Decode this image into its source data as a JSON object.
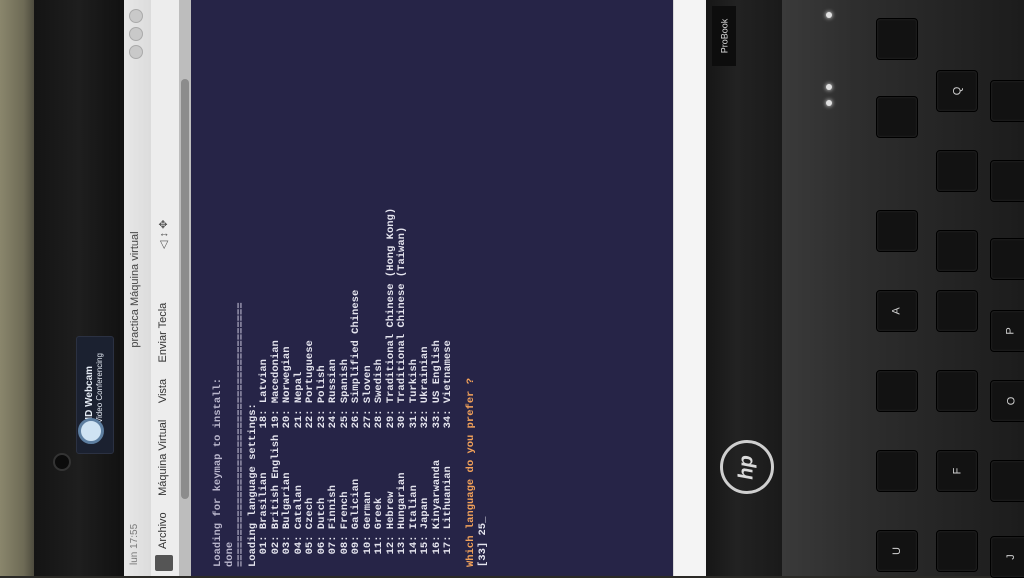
{
  "window": {
    "title": "practica Máquina virtual",
    "clock": "lun 17:55"
  },
  "menu": {
    "items": [
      "Archivo",
      "Máquina Virtual",
      "Vista",
      "Enviar Tecla"
    ]
  },
  "webcam": {
    "title": "HD Webcam",
    "subtitle": "HD Video Conferencing"
  },
  "hardware": {
    "brand": "hp",
    "model": "ProBook",
    "keys": [
      "Q",
      "A",
      "P",
      "O",
      "U",
      "J",
      "F"
    ]
  },
  "console": {
    "header_lines": [
      "Loading for keymap to install:",
      "done",
      "==========================================",
      "Loading language settings:"
    ],
    "languages_left": [
      "01: Brasilian",
      "02: British English",
      "03: Bulgarian",
      "04: Catalan",
      "05: Czech",
      "06: Dutch",
      "07: Finnish",
      "08: French",
      "09: Galician",
      "10: German",
      "11: Greek",
      "12: Hebrew",
      "13: Hungarian",
      "14: Italian",
      "15: Japan",
      "16: Kinyarwanda",
      "17: Lithuanian"
    ],
    "languages_right": [
      "18: Latvian",
      "19: Macedonian",
      "20: Norwegian",
      "21: Nepal",
      "22: Portuguese",
      "23: Polish",
      "24: Russian",
      "25: Spanish",
      "26: Simplified Chinese",
      "27: Sloven",
      "28: Swedish",
      "29: Traditional Chinese (Hong Kong)",
      "30: Traditional Chinese (Taiwan)",
      "31: Turkish",
      "32: Ukrainian",
      "33: US English",
      "34: Vietnamese"
    ],
    "prompt": "Which language do you prefer ?",
    "input_line": "[33] 25_"
  }
}
